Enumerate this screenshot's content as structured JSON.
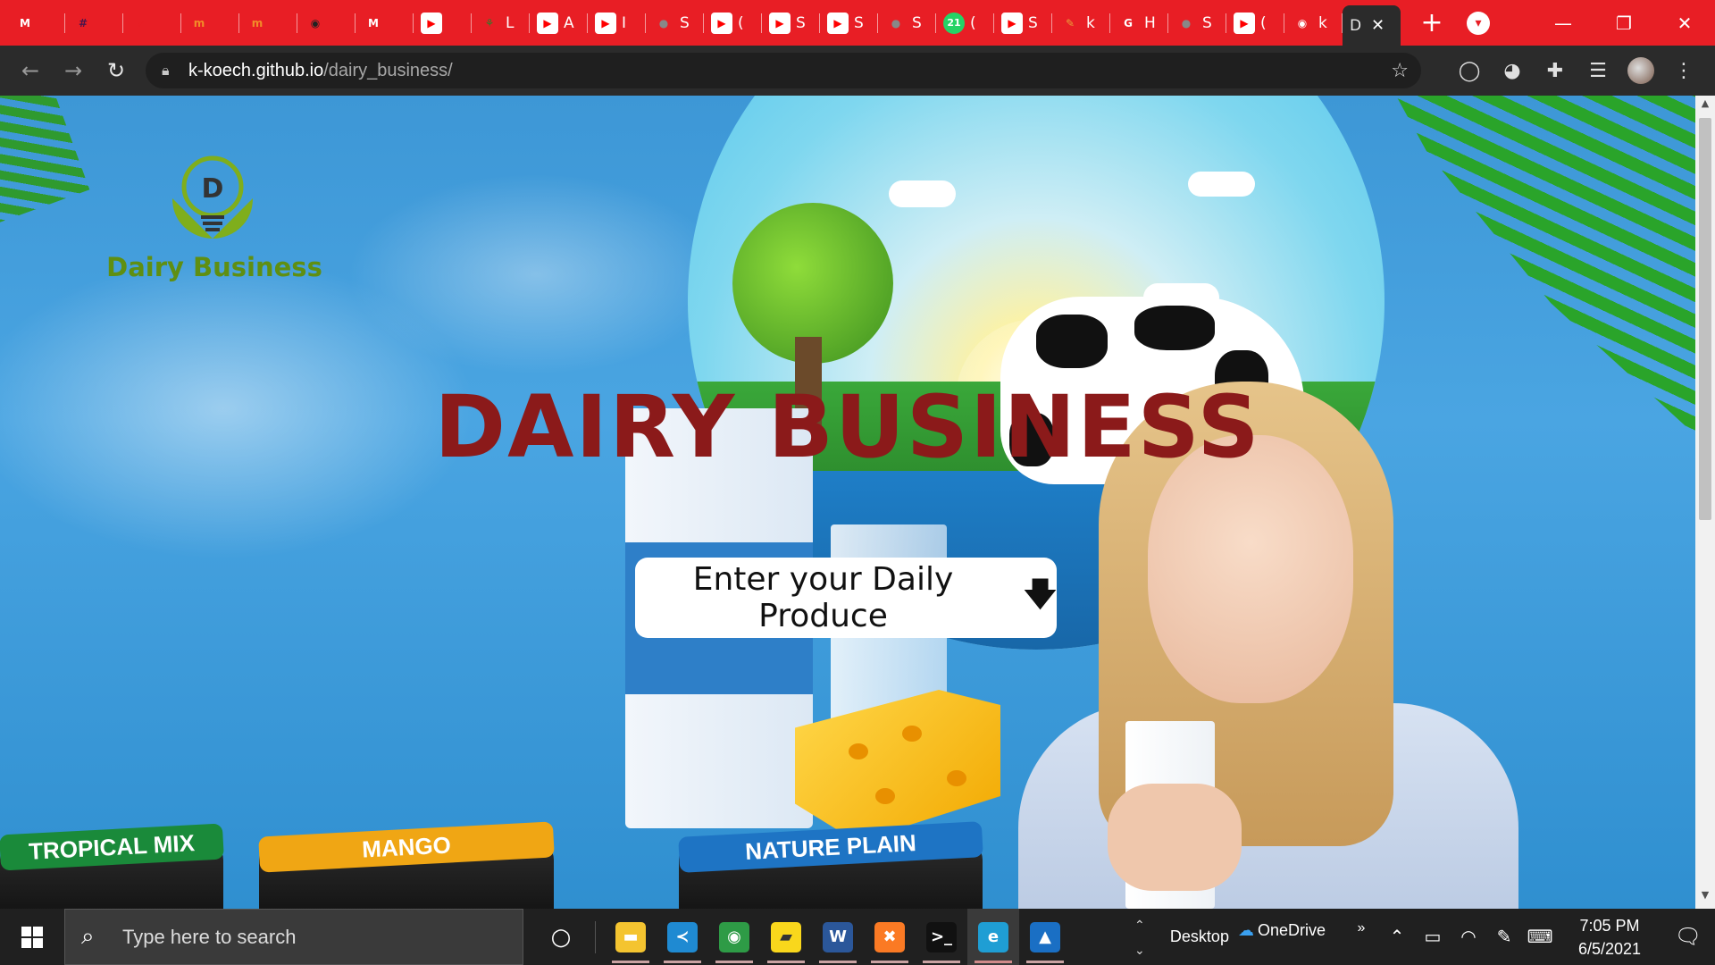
{
  "browser": {
    "tabs": [
      {
        "icon": "gmail-icon",
        "label": "",
        "color": "#ffffff"
      },
      {
        "icon": "slack-icon",
        "label": "",
        "color": "#4a154b"
      },
      {
        "icon": "rocket-icon",
        "label": "",
        "color": "#e81e25"
      },
      {
        "icon": "moringa-icon",
        "label": "",
        "color": "#f28c28"
      },
      {
        "icon": "moringa-icon",
        "label": "",
        "color": "#f28c28"
      },
      {
        "icon": "game-icon",
        "label": "",
        "color": "#222222"
      },
      {
        "icon": "gmail-icon",
        "label": "",
        "color": "#ffffff"
      },
      {
        "icon": "youtube-icon",
        "label": "",
        "color": "#ff0000"
      },
      {
        "icon": "plant-icon",
        "label": "L",
        "color": "#2a7f2a"
      },
      {
        "icon": "youtube-icon",
        "label": "A",
        "color": "#ff0000"
      },
      {
        "icon": "youtube-icon",
        "label": "I",
        "color": "#ff0000"
      },
      {
        "icon": "globe-icon",
        "label": "S",
        "color": "#888888"
      },
      {
        "icon": "youtube-icon",
        "label": "(",
        "color": "#ff0000"
      },
      {
        "icon": "youtube-icon",
        "label": "S",
        "color": "#ff0000"
      },
      {
        "icon": "youtube-icon",
        "label": "S",
        "color": "#ff0000"
      },
      {
        "icon": "globe-icon",
        "label": "S",
        "color": "#888888"
      },
      {
        "icon": "whatsapp-icon",
        "label": "(",
        "color": "#25d366",
        "badge": "21"
      },
      {
        "icon": "youtube-icon",
        "label": "S",
        "color": "#ff0000"
      },
      {
        "icon": "pen-icon",
        "label": "k",
        "color": "#e8a33a"
      },
      {
        "icon": "google-icon",
        "label": "H",
        "color": "#ffffff"
      },
      {
        "icon": "globe-icon",
        "label": "S",
        "color": "#888888"
      },
      {
        "icon": "youtube-icon",
        "label": "(",
        "color": "#ff0000"
      },
      {
        "icon": "github-icon",
        "label": "k",
        "color": "#ffffff"
      }
    ],
    "active_tab": {
      "label": "D",
      "close": "✕"
    },
    "new_tab": "+",
    "url_host": "k-koech.github.io",
    "url_path": "/dairy_business/",
    "colors": {
      "tabstrip": "#e81e25",
      "toolbar": "#2b2b2b"
    }
  },
  "page": {
    "logo_letter": "D",
    "logo_text": "Dairy Business",
    "hero_title": "DAIRY BUSINESS",
    "cta_label": "Enter your Daily Produce",
    "cta_icon": "arrow-down-icon",
    "yogurt_lids": [
      "TROPICAL MIX",
      "MANGO",
      "NATURE PLAIN"
    ],
    "colors": {
      "title": "#8b1a1a",
      "logo_green": "#5f8f12"
    }
  },
  "taskbar": {
    "search_placeholder": "Type here to search",
    "apps": [
      {
        "name": "file-explorer-icon",
        "color": "#f4c430"
      },
      {
        "name": "vscode-icon",
        "color": "#1f8ad2"
      },
      {
        "name": "chrome-icon",
        "color": "#2e9b46"
      },
      {
        "name": "sticky-notes-icon",
        "color": "#f9d71c"
      },
      {
        "name": "word-icon",
        "color": "#2b579a"
      },
      {
        "name": "xampp-icon",
        "color": "#fb7a24"
      },
      {
        "name": "terminal-icon",
        "color": "#111111"
      },
      {
        "name": "edge-icon",
        "color": "#1f9ed4"
      },
      {
        "name": "photos-icon",
        "color": "#1a6fc4"
      }
    ],
    "desktop_label": "Desktop",
    "onedrive_label": "OneDrive",
    "time": "7:05 PM",
    "date": "6/5/2021"
  }
}
